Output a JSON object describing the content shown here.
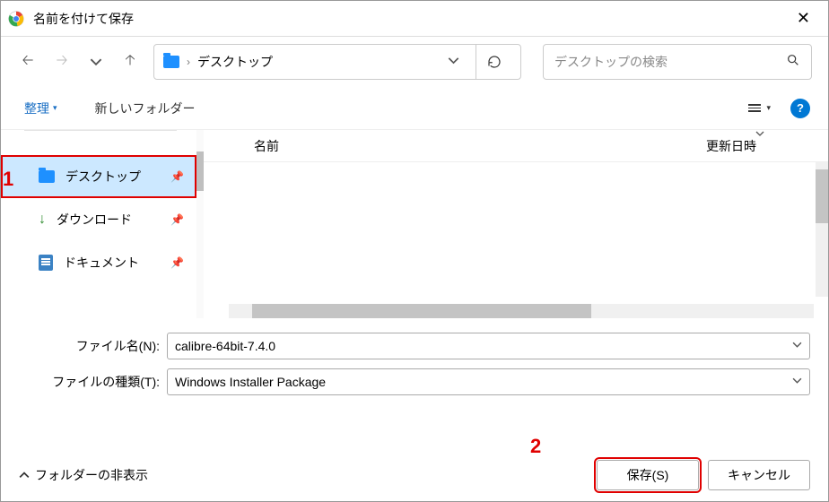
{
  "title": "名前を付けて保存",
  "breadcrumb": {
    "location": "デスクトップ"
  },
  "search": {
    "placeholder": "デスクトップの検索"
  },
  "toolbar": {
    "organize": "整理",
    "new_folder": "新しいフォルダー"
  },
  "columns": {
    "name": "名前",
    "date": "更新日時"
  },
  "sidebar": {
    "items": [
      {
        "label": "デスクトップ"
      },
      {
        "label": "ダウンロード"
      },
      {
        "label": "ドキュメント"
      }
    ]
  },
  "form": {
    "filename_label": "ファイル名(N):",
    "filename_value": "calibre-64bit-7.4.0",
    "filetype_label": "ファイルの種類(T):",
    "filetype_value": "Windows Installer Package"
  },
  "footer": {
    "hide_folders": "フォルダーの非表示",
    "save": "保存(S)",
    "cancel": "キャンセル"
  },
  "callouts": {
    "one": "1",
    "two": "2"
  }
}
